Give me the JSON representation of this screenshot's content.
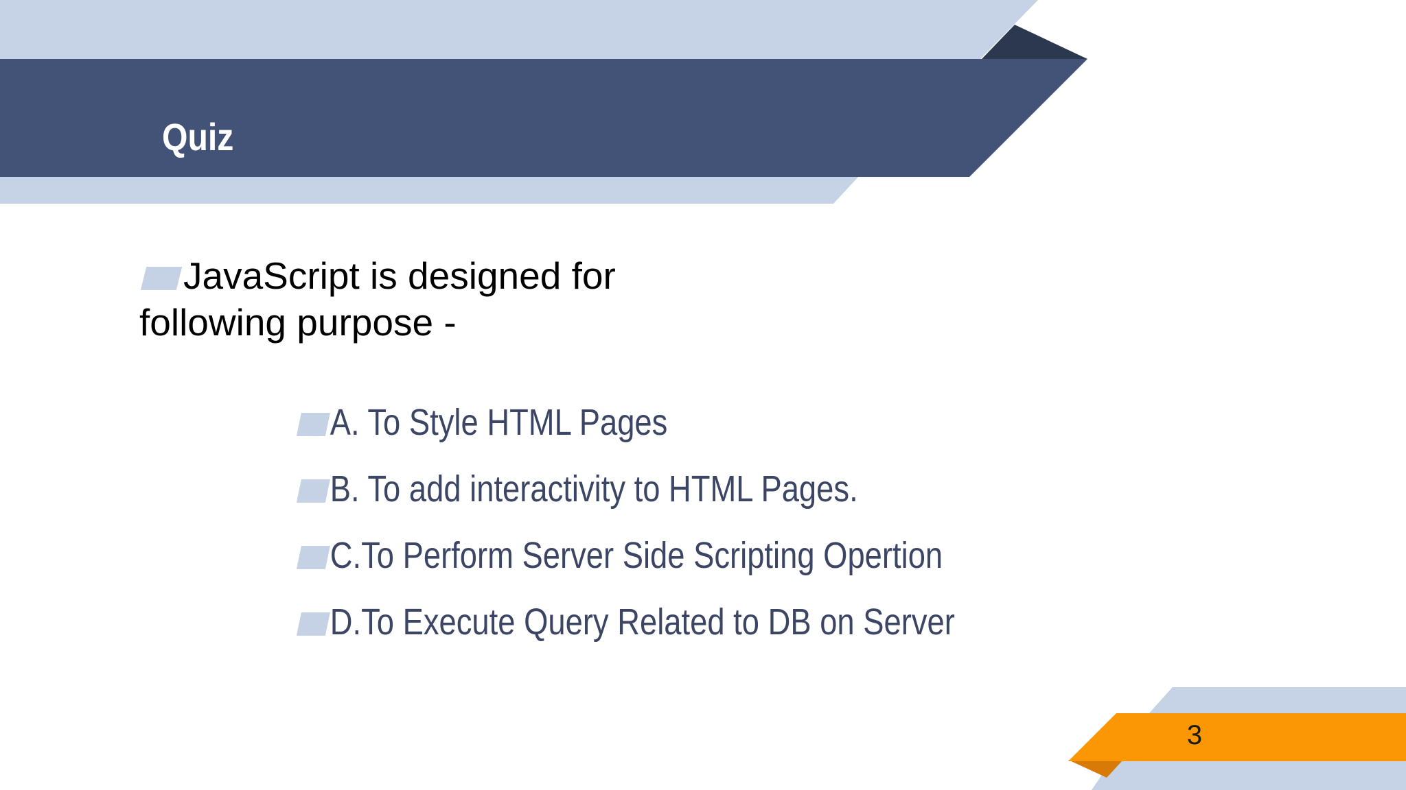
{
  "slide": {
    "title": "Quiz",
    "question": "JavaScript is designed for following purpose -",
    "options": [
      "A. To Style HTML Pages",
      "B. To add interactivity to HTML Pages.",
      "C.To Perform Server Side Scripting Opertion",
      "D.To Execute Query Related to DB on Server"
    ],
    "page_number": "3"
  },
  "colors": {
    "header_band": "#435378",
    "light_band": "#c6d3e6",
    "dark_fold": "#2c3850",
    "accent_orange": "#fb9605",
    "orange_fold": "#d87a08",
    "option_text": "#3c4664"
  },
  "icons": {
    "bullet": "slanted-bar-bullet"
  }
}
